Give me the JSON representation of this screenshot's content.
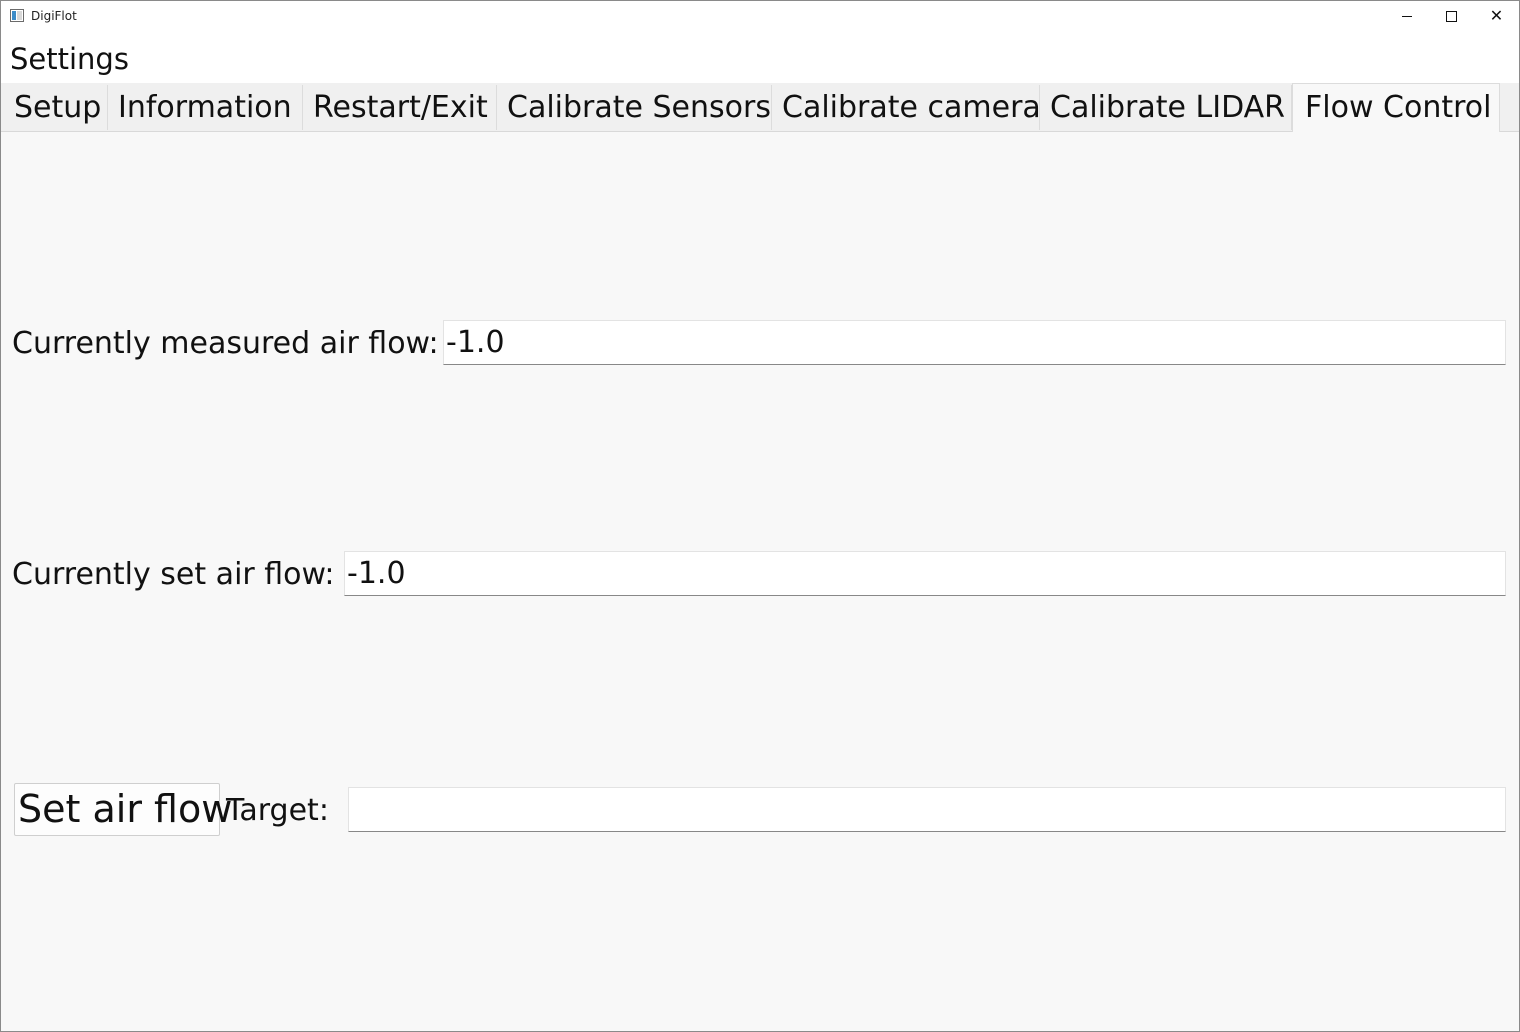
{
  "window": {
    "title": "DigiFlot",
    "minimize_icon": "minimize-icon",
    "maximize_icon": "maximize-icon",
    "close_icon": "close-icon"
  },
  "menubar": {
    "settings_label": "Settings"
  },
  "tabs": [
    {
      "label": "Setup",
      "active": false
    },
    {
      "label": "Information",
      "active": false
    },
    {
      "label": "Restart/Exit",
      "active": false
    },
    {
      "label": "Calibrate Sensors",
      "active": false
    },
    {
      "label": "Calibrate camera",
      "active": false
    },
    {
      "label": "Calibrate LIDAR",
      "active": false
    },
    {
      "label": "Flow Control",
      "active": true
    }
  ],
  "flow_control": {
    "measured_label": "Currently measured air flow:",
    "measured_value": "-1.0",
    "set_label": "Currently set air flow:",
    "set_value": "-1.0",
    "set_button_label": "Set air flow",
    "target_label": "Target:",
    "target_value": ""
  }
}
